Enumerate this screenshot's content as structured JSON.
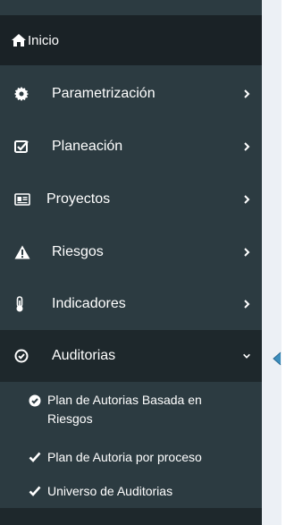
{
  "sidebar": {
    "home": {
      "label": "Inicio",
      "icon": "home-icon"
    },
    "items": [
      {
        "label": "Parametrización",
        "icon": "gear-icon",
        "expanded": false
      },
      {
        "label": "Planeación",
        "icon": "check-square-icon",
        "expanded": false
      },
      {
        "label": "Proyectos",
        "icon": "id-card-icon",
        "expanded": false
      },
      {
        "label": "Riesgos",
        "icon": "warning-icon",
        "expanded": false
      },
      {
        "label": "Indicadores",
        "icon": "thermometer-icon",
        "expanded": false
      },
      {
        "label": "Auditorias",
        "icon": "check-circle-icon",
        "expanded": true
      }
    ],
    "submenu": [
      {
        "label": "Plan de Autorias Basada en Riesgos",
        "icon": "check-circle-icon"
      },
      {
        "label": "Plan de Autoria por proceso",
        "icon": "check-icon"
      },
      {
        "label": "Universo de Auditorias",
        "icon": "check-icon"
      }
    ]
  },
  "colors": {
    "sidebar_bg": "#2c3b41",
    "active_bg": "#1e282c",
    "home_bg": "#1a2226",
    "content_bg": "#ecf0f5",
    "text": "#ffffff",
    "pointer": "#3c8dbc"
  }
}
